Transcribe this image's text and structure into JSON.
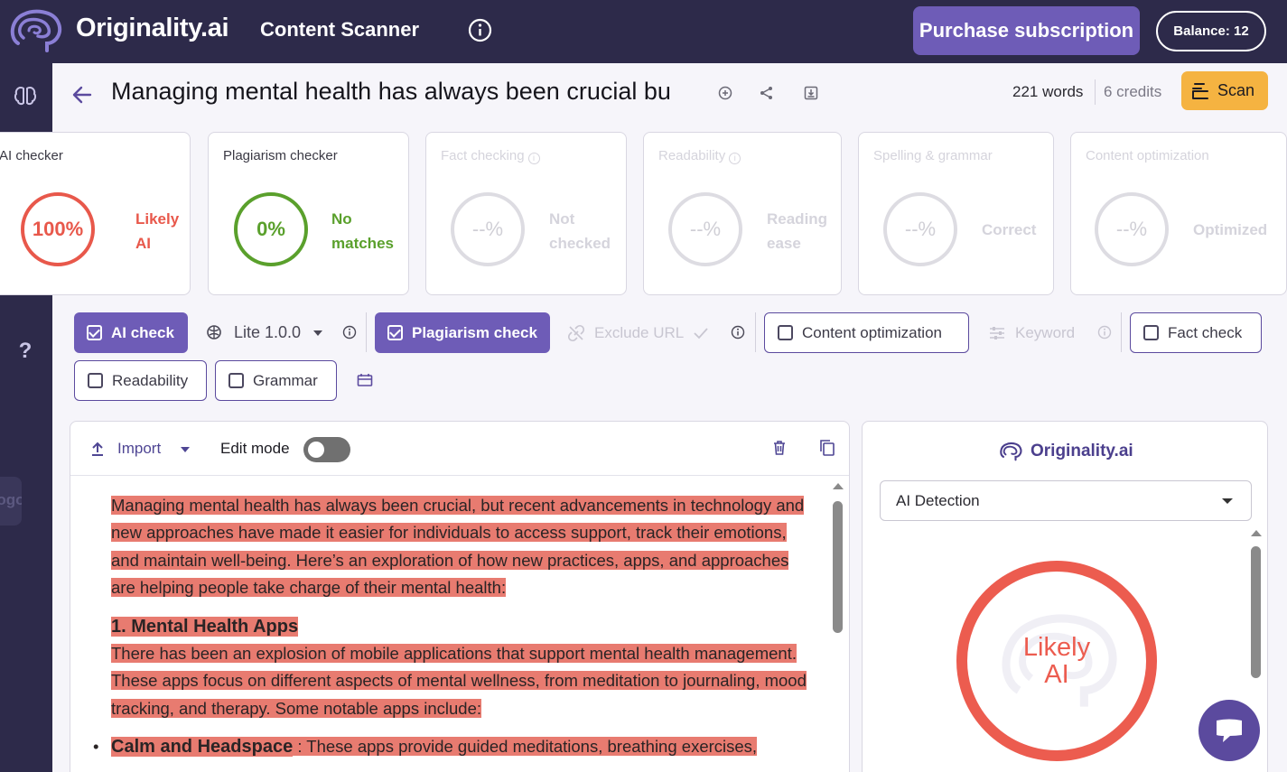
{
  "header": {
    "logo_text": "Originality.ai",
    "app_title": "Content Scanner",
    "purchase_label": "Purchase subscription",
    "balance_label": "Balance: 12"
  },
  "sidebar": {
    "items": [
      "brain-icon",
      "scan-icon",
      "gear-icon",
      "star-icon",
      "help-icon"
    ],
    "logout_label": "Logout"
  },
  "document": {
    "title": "Managing mental health has always been crucial bu",
    "words": "221 words",
    "credits": "6 credits",
    "scan_label": "Scan"
  },
  "cards": {
    "ai": {
      "title": "AI checker",
      "value": "100%",
      "label_line1": "Likely",
      "label_line2": "AI",
      "color": "#e8584b"
    },
    "plagiarism": {
      "title": "Plagiarism checker",
      "value": "0%",
      "label_line1": "No",
      "label_line2": "matches",
      "color": "#5aa02c"
    },
    "fact": {
      "title": "Fact checking",
      "value": "--%",
      "label_line1": "Not",
      "label_line2": "checked"
    },
    "readability": {
      "title": "Readability",
      "value": "--%",
      "label_line1": "Reading",
      "label_line2": "ease"
    },
    "spelling": {
      "title": "Spelling & grammar",
      "value": "--%",
      "label": "Correct"
    },
    "content": {
      "title": "Content optimization",
      "value": "--%",
      "label": "Optimized"
    }
  },
  "toolbar": {
    "ai_check": "AI check",
    "model": "Lite 1.0.0",
    "plagiarism_check": "Plagiarism check",
    "exclude_url": "Exclude URL",
    "content_optimization": "Content optimization",
    "keyword": "Keyword",
    "fact_check": "Fact check",
    "readability": "Readability",
    "grammar": "Grammar"
  },
  "editor": {
    "import_label": "Import",
    "edit_mode_label": "Edit mode",
    "edit_mode_on": false,
    "paragraph1": "Managing mental health has always been crucial, but recent advancements in technology and new approaches have made it easier for individuals to access support, track their emotions, and maintain well-being.  Here’s an exploration of how new practices, apps, and approaches are helping people take charge of their mental health:",
    "heading1": "1. Mental Health Apps",
    "paragraph2": "There has been an explosion of mobile applications that support mental health management.  These apps focus on different aspects of mental wellness, from meditation to journaling, mood tracking, and therapy.  Some notable apps include:",
    "bullet1_bold": "Calm and Headspace",
    "bullet1_rest": " : These apps provide guided meditations, breathing exercises,"
  },
  "result_panel": {
    "logo_text": "Originality.ai",
    "mode": "AI Detection",
    "verdict_line1": "Likely",
    "verdict_line2": "AI",
    "color": "#ec5c4f"
  },
  "colors": {
    "nav_bg": "#2d2a4a",
    "accent": "#6e5cb7",
    "scan": "#f5b341",
    "highlight": "#e87b70"
  }
}
